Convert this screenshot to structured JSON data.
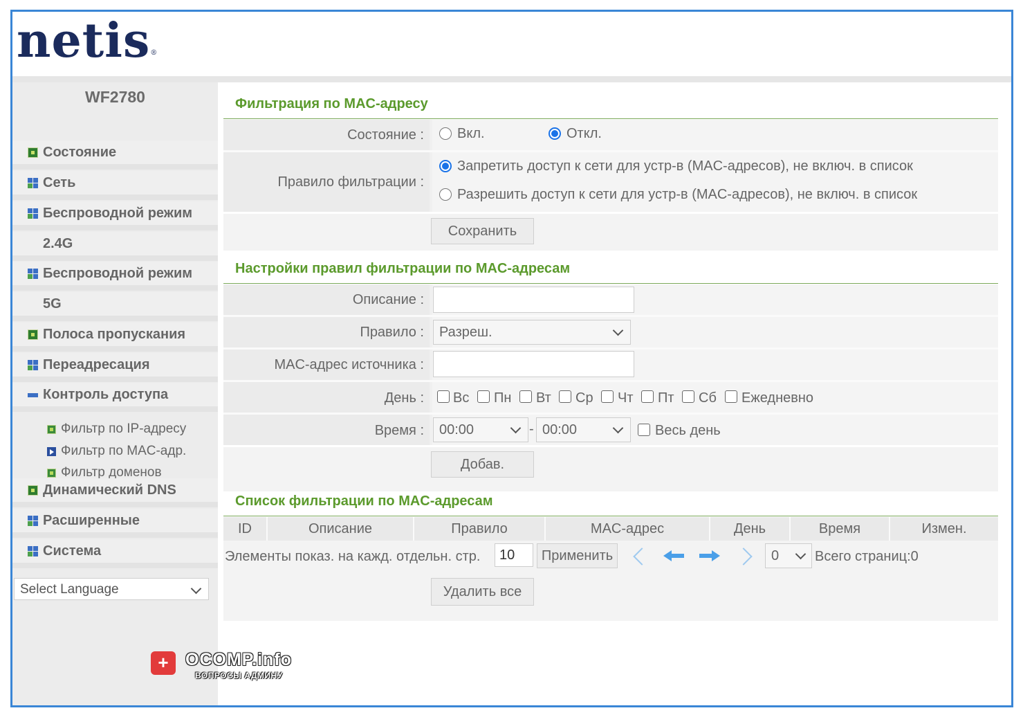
{
  "header": {
    "logo": "netis"
  },
  "sidebar": {
    "model": "WF2780",
    "items": [
      {
        "label": "Состояние",
        "icon": "single"
      },
      {
        "label": "Сеть",
        "icon": "grid"
      },
      {
        "label": "Беспроводной режим",
        "icon": "grid"
      },
      {
        "label": "2.4G",
        "icon": "none"
      },
      {
        "label": "Беспроводной режим",
        "icon": "grid"
      },
      {
        "label": "5G",
        "icon": "none"
      },
      {
        "label": "Полоса пропускания",
        "icon": "single"
      },
      {
        "label": "Переадресация",
        "icon": "grid"
      },
      {
        "label": "Контроль доступа",
        "icon": "minus"
      },
      {
        "label": "Динамический DNS",
        "icon": "single"
      },
      {
        "label": "Расширенные",
        "icon": "grid"
      },
      {
        "label": "Система",
        "icon": "grid"
      }
    ],
    "subitems": [
      {
        "label": "Фильтр по IP-адресу",
        "icon": "square"
      },
      {
        "label": "Фильтр по MAC-адр.",
        "icon": "play"
      },
      {
        "label": "Фильтр доменов",
        "icon": "square"
      }
    ],
    "language": "Select Language"
  },
  "filter": {
    "title": "Фильтрация по MAC-адресу",
    "state_label": "Состояние :",
    "state_on": "Вкл.",
    "state_off": "Откл.",
    "rule_label": "Правило фильтрации :",
    "rule_deny": "Запретить доступ к сети для устр-в (MAC-адресов), не включ. в список",
    "rule_allow": "Разрешить доступ к сети для устр-в (MAC-адресов), не включ. в список",
    "save": "Сохранить"
  },
  "rules": {
    "title": "Настройки правил фильтрации по MAC-адресам",
    "desc_label": "Описание :",
    "desc_value": "",
    "rule_label": "Правило :",
    "rule_value": "Разреш.",
    "mac_label": "MAC-адрес источника :",
    "mac_value": "",
    "day_label": "День :",
    "days": [
      "Вс",
      "Пн",
      "Вт",
      "Ср",
      "Чт",
      "Пт",
      "Сб",
      "Ежедневно"
    ],
    "time_label": "Время :",
    "time_from": "00:00",
    "time_dash": "-",
    "time_to": "00:00",
    "all_day": "Весь день",
    "add": "Добав."
  },
  "list": {
    "title": "Список фильтрации по MAC-адресам",
    "columns": [
      "ID",
      "Описание",
      "Правило",
      "MAC-адрес",
      "День",
      "Время",
      "Измен."
    ],
    "per_page_label": "Элементы показ. на кажд. отдельн. стр.",
    "per_page_value": "10",
    "apply": "Применить",
    "page_value": "0",
    "total_pages": "Всего страниц:0",
    "delete_all": "Удалить все"
  },
  "watermark": {
    "brand": "OCOMP.info",
    "tagline": "ВОПРОСЫ АДМИНУ"
  },
  "colors": {
    "frame": "#3a86d6",
    "section_title": "#5b9a2c",
    "logo": "#1b2b5c",
    "radio_selected": "#1a73e8"
  }
}
